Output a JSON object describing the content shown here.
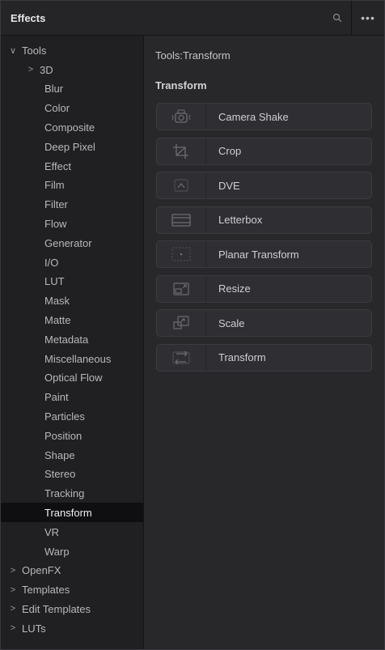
{
  "panel": {
    "title": "Effects",
    "search_icon": "search-icon",
    "more_label": "•••"
  },
  "sidebar": {
    "tools": {
      "caret": "∨",
      "label": "Tools"
    },
    "items": [
      {
        "label": "3D",
        "caret": ">"
      },
      {
        "label": "Blur"
      },
      {
        "label": "Color"
      },
      {
        "label": "Composite"
      },
      {
        "label": "Deep Pixel"
      },
      {
        "label": "Effect"
      },
      {
        "label": "Film"
      },
      {
        "label": "Filter"
      },
      {
        "label": "Flow"
      },
      {
        "label": "Generator"
      },
      {
        "label": "I/O"
      },
      {
        "label": "LUT"
      },
      {
        "label": "Mask"
      },
      {
        "label": "Matte"
      },
      {
        "label": "Metadata"
      },
      {
        "label": "Miscellaneous"
      },
      {
        "label": "Optical Flow"
      },
      {
        "label": "Paint"
      },
      {
        "label": "Particles"
      },
      {
        "label": "Position"
      },
      {
        "label": "Shape"
      },
      {
        "label": "Stereo"
      },
      {
        "label": "Tracking"
      },
      {
        "label": "Transform",
        "selected": true
      },
      {
        "label": "VR"
      },
      {
        "label": "Warp"
      }
    ],
    "roots": [
      {
        "label": "OpenFX",
        "caret": ">"
      },
      {
        "label": "Templates",
        "caret": ">"
      },
      {
        "label": "Edit Templates",
        "caret": ">"
      },
      {
        "label": "LUTs",
        "caret": ">"
      }
    ]
  },
  "main": {
    "path": "Tools:Transform",
    "section": "Transform",
    "tools": [
      {
        "label": "Camera Shake",
        "icon": "camera-shake-icon"
      },
      {
        "label": "Crop",
        "icon": "crop-icon"
      },
      {
        "label": "DVE",
        "icon": "dve-icon"
      },
      {
        "label": "Letterbox",
        "icon": "letterbox-icon"
      },
      {
        "label": "Planar Transform",
        "icon": "planar-transform-icon"
      },
      {
        "label": "Resize",
        "icon": "resize-icon"
      },
      {
        "label": "Scale",
        "icon": "scale-icon"
      },
      {
        "label": "Transform",
        "icon": "transform-icon"
      }
    ]
  }
}
